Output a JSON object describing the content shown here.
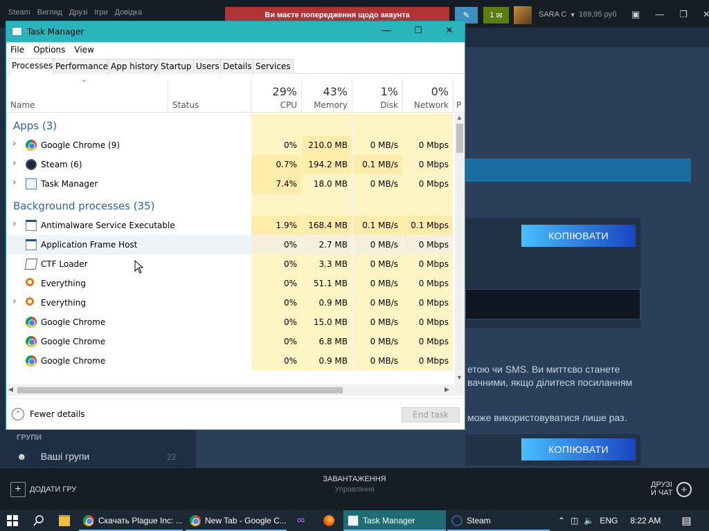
{
  "steam": {
    "menu": [
      "Steam",
      "Вигляд",
      "Друзі",
      "Ігри",
      "Довідка"
    ],
    "warning": "Ви маєте попередження щодо акаунта",
    "notif_count": "1",
    "account_name": "SARA C",
    "balance": "169,95 руб",
    "copy_button_1": "КОПІЮВАТИ",
    "copy_button_2": "КОПІЮВАТИ",
    "text_line1": "етою чи SMS. Ви миттєво станете",
    "text_line2": "вачними, якщо ділитеся посиланням",
    "text_line3": "може використовуватися лише раз.",
    "groups_header": "ГРУПИ",
    "groups_item": "Ваші групи",
    "groups_count": "22",
    "add_game": "ДОДАТИ ГРУ",
    "downloads_title": "ЗАВАНТАЖЕННЯ",
    "downloads_sub": "Управління",
    "friends_line1": "ДРУЗІ",
    "friends_line2": "И ЧАТ"
  },
  "taskmanager": {
    "title": "Task Manager",
    "menu": [
      "File",
      "Options",
      "View"
    ],
    "tabs": [
      "Processes",
      "Performance",
      "App history",
      "Startup",
      "Users",
      "Details",
      "Services"
    ],
    "columns": {
      "name": "Name",
      "status": "Status",
      "cpu_pct": "29%",
      "cpu": "CPU",
      "mem_pct": "43%",
      "mem": "Memory",
      "disk_pct": "1%",
      "disk": "Disk",
      "net_pct": "0%",
      "net": "Network",
      "extra": "P"
    },
    "group_apps": "Apps (3)",
    "group_bg": "Background processes (35)",
    "apps": [
      {
        "name": "Google Chrome (9)",
        "icon": "chrome-icon",
        "cpu": "0%",
        "mem": "210.0 MB",
        "disk": "0 MB/s",
        "net": "0 Mbps"
      },
      {
        "name": "Steam (6)",
        "icon": "steam-icon",
        "cpu": "0.7%",
        "mem": "194.2 MB",
        "disk": "0.1 MB/s",
        "net": "0 Mbps"
      },
      {
        "name": "Task Manager",
        "icon": "task-manager-icon",
        "cpu": "7.4%",
        "mem": "18.0 MB",
        "disk": "0 MB/s",
        "net": "0 Mbps"
      }
    ],
    "background": [
      {
        "name": "Antimalware Service Executable",
        "icon": "window-icon",
        "cpu": "1.9%",
        "mem": "168.4 MB",
        "disk": "0.1 MB/s",
        "net": "0.1 Mbps"
      },
      {
        "name": "Application Frame Host",
        "icon": "window-icon",
        "cpu": "0%",
        "mem": "2.7 MB",
        "disk": "0 MB/s",
        "net": "0 Mbps"
      },
      {
        "name": "CTF Loader",
        "icon": "ctf-icon",
        "cpu": "0%",
        "mem": "3.3 MB",
        "disk": "0 MB/s",
        "net": "0 Mbps"
      },
      {
        "name": "Everything",
        "icon": "everything-icon",
        "cpu": "0%",
        "mem": "51.1 MB",
        "disk": "0 MB/s",
        "net": "0 Mbps"
      },
      {
        "name": "Everything",
        "icon": "everything-icon",
        "cpu": "0%",
        "mem": "0.9 MB",
        "disk": "0 MB/s",
        "net": "0 Mbps"
      },
      {
        "name": "Google Chrome",
        "icon": "chrome-icon",
        "cpu": "0%",
        "mem": "15.0 MB",
        "disk": "0 MB/s",
        "net": "0 Mbps"
      },
      {
        "name": "Google Chrome",
        "icon": "chrome-icon",
        "cpu": "0%",
        "mem": "6.8 MB",
        "disk": "0 MB/s",
        "net": "0 Mbps"
      },
      {
        "name": "Google Chrome",
        "icon": "chrome-icon",
        "cpu": "0%",
        "mem": "0.9 MB",
        "disk": "0 MB/s",
        "net": "0 Mbps"
      }
    ],
    "fewer_details": "Fewer details",
    "end_task": "End task"
  },
  "taskbar": {
    "items": [
      {
        "label": "Скачать Plague Inc: ...",
        "icon": "chrome-icon"
      },
      {
        "label": "New Tab - Google C...",
        "icon": "chrome-icon"
      },
      {
        "label": "Task Manager",
        "icon": "task-manager-icon"
      },
      {
        "label": "Steam",
        "icon": "steam-icon"
      }
    ],
    "lang": "ENG",
    "time": "8:22 AM"
  },
  "colors": {
    "accent": "#2ab5bd",
    "steam_bg": "#1b2838",
    "warning": "#b13434",
    "cpu_heat": "#fff4c4",
    "cpu_heat_strong": "#ffecaa"
  }
}
